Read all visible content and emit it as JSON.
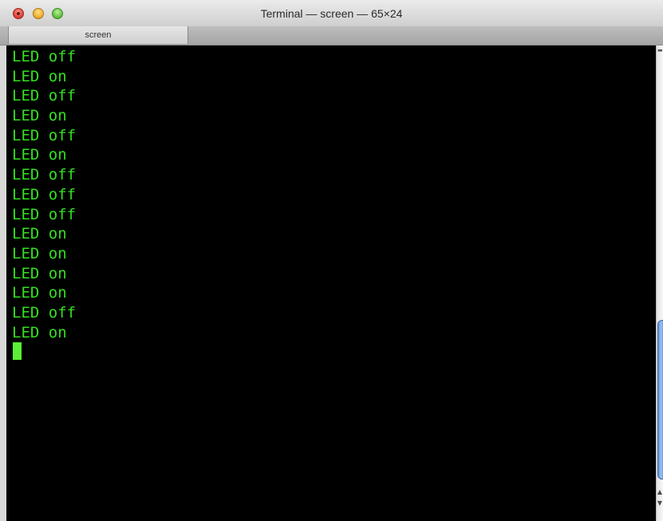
{
  "window": {
    "title": "Terminal — screen — 65×24"
  },
  "tabs": [
    {
      "label": "screen"
    }
  ],
  "terminal": {
    "lines": [
      "LED off",
      "LED on",
      "LED off",
      "LED on",
      "LED off",
      "LED on",
      "LED off",
      "LED off",
      "LED off",
      "LED on",
      "LED on",
      "LED on",
      "LED on",
      "LED off",
      "LED on"
    ],
    "text_color": "#33e01f",
    "background": "#000000",
    "cursor_color": "#5cf035"
  },
  "icons": {
    "close": "close-icon",
    "minimize": "minimize-icon",
    "zoom": "zoom-icon",
    "scroll_up": "chevron-up-icon",
    "scroll_down": "chevron-down-icon"
  }
}
